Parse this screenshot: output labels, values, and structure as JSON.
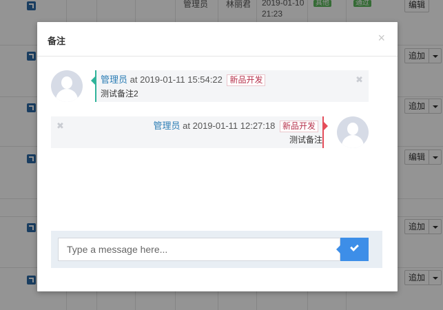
{
  "background": {
    "top_row": {
      "role": "管理员",
      "user": "林丽君",
      "date": "2019-01-10",
      "time": "21:23",
      "tag1": "其他",
      "tag2": "通过",
      "edit": "编辑"
    },
    "row_buttons": [
      "追加",
      "追加",
      "编辑",
      "追加",
      "追加"
    ]
  },
  "modal": {
    "title": "备注",
    "close": "×"
  },
  "comments": [
    {
      "name": "管理员",
      "at": "at 2019-01-11 15:54:22",
      "dept": "新品开发",
      "text": "测试备注2",
      "delete": "✖"
    },
    {
      "name": "管理员",
      "at": "at 2019-01-11 12:27:18",
      "dept": "新品开发",
      "text": "测试备注",
      "delete": "✖"
    }
  ],
  "composer": {
    "placeholder": "Type a message here...",
    "send_icon": "check-icon"
  },
  "colors": {
    "accent_left": "#2fb39a",
    "accent_right": "#e54d5a",
    "send": "#3d8ee8",
    "name": "#2b7db5"
  }
}
